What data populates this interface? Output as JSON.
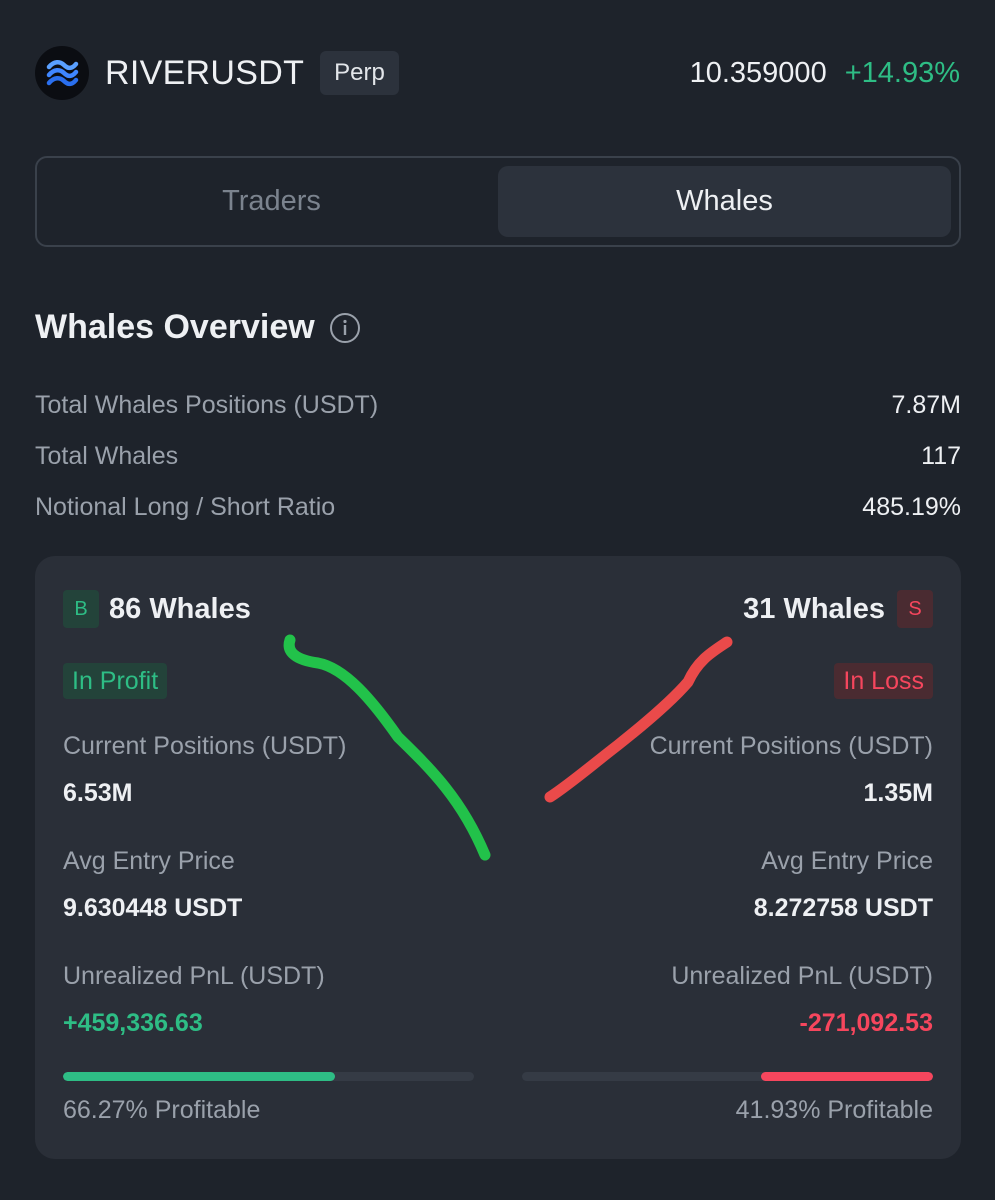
{
  "header": {
    "logo_icon": "river-waves-logo-icon",
    "symbol": "RIVERUSDT",
    "badge": "Perp",
    "price": "10.359000",
    "change": "+14.93%"
  },
  "tabs": [
    {
      "label": "Traders",
      "active": false
    },
    {
      "label": "Whales",
      "active": true
    }
  ],
  "overview": {
    "title": "Whales Overview",
    "info_icon": "info-circle-icon",
    "stats": [
      {
        "label": "Total Whales Positions (USDT)",
        "value": "7.87M"
      },
      {
        "label": "Total Whales",
        "value": "117"
      },
      {
        "label": "Notional Long / Short Ratio",
        "value": "485.19%"
      }
    ]
  },
  "long_side": {
    "badge": "B",
    "count": "86 Whales",
    "status": "In Profit",
    "positions_label": "Current Positions (USDT)",
    "positions_value": "6.53M",
    "entry_label": "Avg Entry Price",
    "entry_value": "9.630448 USDT",
    "pnl_label": "Unrealized PnL (USDT)",
    "pnl_value": "+459,336.63",
    "profitable_text": "66.27% Profitable",
    "profitable_fraction": 0.6627
  },
  "short_side": {
    "badge": "S",
    "count": "31 Whales",
    "status": "In Loss",
    "positions_label": "Current Positions (USDT)",
    "positions_value": "1.35M",
    "entry_label": "Avg Entry Price",
    "entry_value": "8.272758 USDT",
    "pnl_label": "Unrealized PnL (USDT)",
    "pnl_value": "-271,092.53",
    "profitable_text": "41.93% Profitable",
    "profitable_fraction": 0.4193
  },
  "colors": {
    "background": "#1e232b",
    "card": "#2a2f38",
    "positive": "#2ebd85",
    "negative": "#f6465d",
    "annotation_green": "#22c24a",
    "annotation_red": "#ea4a4a"
  }
}
